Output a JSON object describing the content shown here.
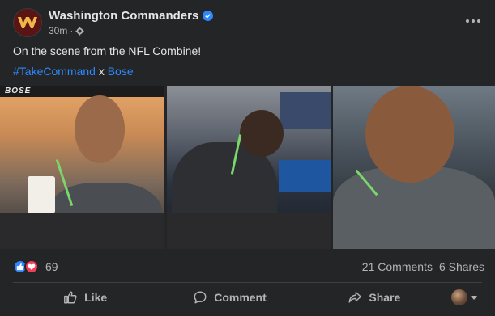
{
  "post": {
    "page_name": "Washington Commanders",
    "timestamp": "30m",
    "separator": "·",
    "text": "On the scene from the NFL Combine!",
    "hashtag": "#TakeCommand",
    "joiner": "x",
    "mention": "Bose"
  },
  "photos": {
    "brand_text": "BOSE",
    "count": 3
  },
  "engagement": {
    "reaction_count": "69",
    "comments": "21 Comments",
    "shares": "6 Shares"
  },
  "actions": {
    "like": "Like",
    "comment": "Comment",
    "share": "Share"
  },
  "icons": [
    "verified-icon",
    "globe-settings-icon",
    "more-options-icon",
    "like-reaction-icon",
    "love-reaction-icon",
    "like-icon",
    "comment-icon",
    "share-icon",
    "caret-down-icon"
  ],
  "colors": {
    "background": "#242526",
    "accent": "#2d88ff",
    "love": "#f33e58",
    "text": "#e4e6eb",
    "muted": "#b0b3b8",
    "brand": "#5a1414"
  }
}
